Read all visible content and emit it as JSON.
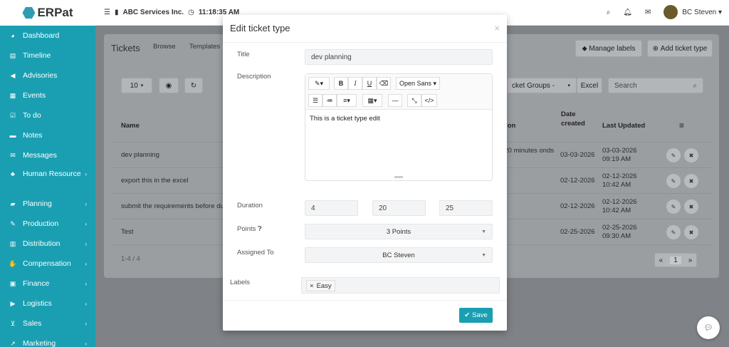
{
  "app": {
    "logo_text": "ERPat",
    "menu_icon": "hamburger-icon",
    "company": "ABC Services Inc.",
    "clock": "11:18:35 AM"
  },
  "topbar": {
    "user_name": "BC Steven ▾"
  },
  "sidebar": {
    "items": [
      {
        "label": "Dashboard",
        "icon": "dashboard-icon",
        "chevron": false
      },
      {
        "label": "Timeline",
        "icon": "timeline-icon",
        "chevron": false
      },
      {
        "label": "Advisories",
        "icon": "megaphone-icon",
        "chevron": false
      },
      {
        "label": "Events",
        "icon": "calendar-icon",
        "chevron": false
      },
      {
        "label": "To do",
        "icon": "checkbox-icon",
        "chevron": false
      },
      {
        "label": "Notes",
        "icon": "notes-icon",
        "chevron": false
      },
      {
        "label": "Messages",
        "icon": "envelope-icon",
        "chevron": false
      },
      {
        "label": "Human Resource",
        "icon": "users-icon",
        "chevron": true
      },
      {
        "label": "Planning",
        "icon": "briefcase-icon",
        "chevron": true
      },
      {
        "label": "Production",
        "icon": "production-icon",
        "chevron": true
      },
      {
        "label": "Distribution",
        "icon": "bank-icon",
        "chevron": true
      },
      {
        "label": "Compensation",
        "icon": "handshake-icon",
        "chevron": true
      },
      {
        "label": "Finance",
        "icon": "money-icon",
        "chevron": true
      },
      {
        "label": "Logistics",
        "icon": "truck-icon",
        "chevron": true
      },
      {
        "label": "Sales",
        "icon": "cart-icon",
        "chevron": true
      },
      {
        "label": "Marketing",
        "icon": "chart-icon",
        "chevron": true
      }
    ]
  },
  "page": {
    "title": "Tickets",
    "tabs": [
      "Browse",
      "Templates"
    ],
    "manage_labels": "Manage labels",
    "add_ticket_type": "Add ticket type",
    "page_size": "10",
    "groups_filter": "cket Groups -",
    "excel": "Excel",
    "search_placeholder": "Search",
    "headers": {
      "name": "Name",
      "duration": "ion",
      "date_created": "Date created",
      "last_updated": "Last Updated"
    },
    "rows": [
      {
        "name": "dev planning",
        "duration": "s 20 minutes onds",
        "created": "03-03-2026",
        "updated": "03-03-2026 09:19 AM"
      },
      {
        "name": "export this in the excel",
        "duration": "",
        "created": "02-12-2026",
        "updated": "02-12-2026 10:42 AM"
      },
      {
        "name": "submit the requirements before du",
        "duration": "",
        "created": "02-12-2026",
        "updated": "02-12-2026 10:42 AM"
      },
      {
        "name": "Test",
        "duration": "",
        "created": "02-25-2026",
        "updated": "02-25-2026 09:30 AM"
      }
    ],
    "record_count": "1-4 / 4",
    "pager": {
      "prev": "«",
      "current": "1",
      "next": "»"
    }
  },
  "modal": {
    "title": "Edit ticket type",
    "close": "×",
    "title_label": "Title",
    "title_value": "dev planning",
    "description_label": "Description",
    "font_name": "Open Sans ▾",
    "description_text": "This is a ticket type edit",
    "duration_label": "Duration",
    "duration_values": [
      "4",
      "20",
      "25"
    ],
    "points_label": "Points",
    "points_value": "3 Points",
    "assigned_label": "Assigned To",
    "assigned_value": "BC Steven",
    "labels_label": "Labels",
    "label_tag": "Easy",
    "save": "Save"
  }
}
